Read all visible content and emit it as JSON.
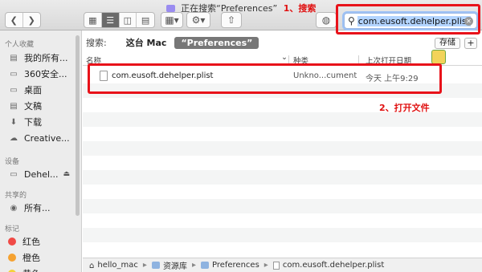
{
  "window": {
    "title": "正在搜索“Preferences”",
    "annotation_search": "1、搜索"
  },
  "toolbar": {
    "back_icon": "chevron-left-icon",
    "forward_icon": "chevron-right-icon",
    "view_icons": [
      "icon-view-icon",
      "list-view-icon",
      "column-view-icon",
      "gallery-view-icon"
    ],
    "active_view_index": 1,
    "group_icon": "group-by-icon",
    "action_icon": "gear-icon",
    "share_icon": "share-icon",
    "tag_icon": "tag-icon"
  },
  "search": {
    "value": "com.eusoft.dehelper.plist"
  },
  "sidebar": {
    "favorites_header": "个人收藏",
    "favorites": [
      {
        "label": "我的所有...",
        "icon": "all-files-icon"
      },
      {
        "label": "360安全...",
        "icon": "folder-icon"
      },
      {
        "label": "桌面",
        "icon": "desktop-icon"
      },
      {
        "label": "文稿",
        "icon": "documents-icon"
      },
      {
        "label": "下载",
        "icon": "download-icon"
      },
      {
        "label": "Creative...",
        "icon": "cloud-icon"
      }
    ],
    "devices_header": "设备",
    "devices": [
      {
        "label": "Dehel...",
        "icon": "disk-icon"
      }
    ],
    "shared_header": "共享的",
    "shared": [
      {
        "label": "所有...",
        "icon": "globe-icon"
      }
    ],
    "tags_header": "标记",
    "tags": [
      {
        "label": "红色",
        "color": "#f04a46"
      },
      {
        "label": "橙色",
        "color": "#f5a231"
      },
      {
        "label": "黄色",
        "color": "#f4d23a"
      }
    ]
  },
  "scope": {
    "label": "搜索:",
    "this_mac": "这台 Mac",
    "preferences": "“Preferences”",
    "save_label": "存储",
    "add_label": "+"
  },
  "columns": {
    "name": "名称",
    "kind": "种类",
    "last_opened": "上次打开日期"
  },
  "results": [
    {
      "name": "com.eusoft.dehelper.plist",
      "kind": "Unkno...cument",
      "date": "今天 上午9:29"
    }
  ],
  "annotation_open": "2、打开文件",
  "pathbar": {
    "items": [
      "hello_mac",
      "资源库",
      "Preferences",
      "com.eusoft.dehelper.plist"
    ]
  },
  "colors": {
    "annotation_red": "#e8121a",
    "search_highlight": "#b3d4ff"
  }
}
